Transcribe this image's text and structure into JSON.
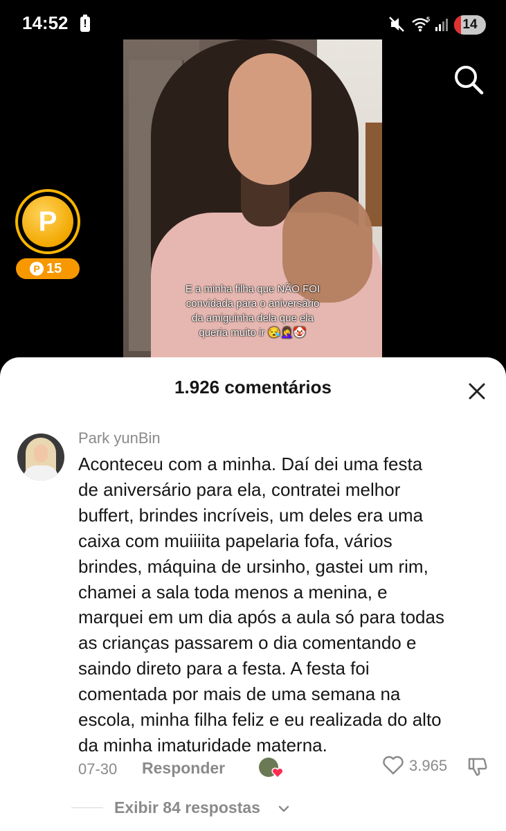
{
  "status_bar": {
    "time": "14:52",
    "battery_warning": "!",
    "battery_level": "14",
    "signal_badge": "5"
  },
  "video": {
    "caption_lines": [
      "E a minha filha que NÃO FOI",
      "convidada para o aniversário",
      "da amiguinha dela que ela",
      "queria muito ir 😪🤦‍♀️🤡"
    ]
  },
  "rewards": {
    "coin_symbol": "P",
    "points": "15"
  },
  "comments": {
    "title": "1.926 comentários",
    "items": [
      {
        "username": "Park yunBin",
        "text_lines": [
          "Aconteceu com a minha. Daí dei uma festa",
          "de aniversário para ela, contratei melhor",
          "buffert, brindes incríveis, um deles era uma",
          "caixa com muiiiita papelaria fofa, vários",
          "brindes, máquina de ursinho, gastei um rim,",
          "chamei a sala toda menos a menina, e",
          "marquei em um dia após a aula só para todas",
          "as crianças passarem o dia comentando e",
          "saindo direto para a festa. A festa foi",
          "comentada por mais de uma semana na",
          "escola, minha filha feliz e eu realizada do alto",
          "da minha imaturidade materna."
        ],
        "date": "07-30",
        "reply_label": "Responder",
        "like_count": "3.965",
        "view_replies_label": "Exibir 84 respostas"
      }
    ]
  },
  "colors": {
    "coin": "#f7b500",
    "muted_text": "#8a8a8a",
    "heart": "#fe2c55"
  }
}
